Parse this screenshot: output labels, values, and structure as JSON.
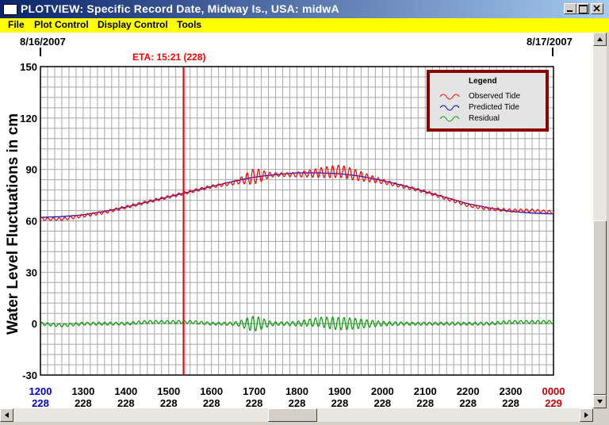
{
  "window": {
    "title": "PLOTVIEW: Specific Record Date, Midway Is., USA: midwA"
  },
  "menu": [
    {
      "label": "File"
    },
    {
      "label": "Plot Control"
    },
    {
      "label": "Display Control"
    },
    {
      "label": "Tools"
    }
  ],
  "header": {
    "left_date": "8/16/2007",
    "right_date": "8/17/2007",
    "eta_label": "ETA: 15:21 (228)"
  },
  "colors": {
    "observed": "#ff0000",
    "predicted": "#0000cc",
    "residual": "#00a000",
    "eta_line": "#ff0000",
    "menu_bg": "#ffff00",
    "title_bg": "#0a246a"
  },
  "chart_data": {
    "type": "line",
    "ylabel": "Water Level Fluctuations in cm",
    "ylim": [
      -30,
      150
    ],
    "yticks": [
      -30,
      0,
      30,
      60,
      90,
      120,
      150
    ],
    "xlim": [
      12.0,
      24.0
    ],
    "xticks": [
      {
        "time": "1200",
        "day": "228",
        "highlight": "blue"
      },
      {
        "time": "1300",
        "day": "228"
      },
      {
        "time": "1400",
        "day": "228"
      },
      {
        "time": "1500",
        "day": "228"
      },
      {
        "time": "1600",
        "day": "228"
      },
      {
        "time": "1700",
        "day": "228"
      },
      {
        "time": "1800",
        "day": "228"
      },
      {
        "time": "1900",
        "day": "228"
      },
      {
        "time": "2000",
        "day": "228"
      },
      {
        "time": "2100",
        "day": "228"
      },
      {
        "time": "2200",
        "day": "228"
      },
      {
        "time": "2300",
        "day": "228"
      },
      {
        "time": "0000",
        "day": "229",
        "highlight": "red"
      }
    ],
    "eta_x": 15.35,
    "grid": true,
    "legend": {
      "title": "Legend",
      "placement": "top-right"
    },
    "series": [
      {
        "name": "Observed Tide",
        "color": "#ff0000",
        "x": [
          12.0,
          12.5,
          13.0,
          13.5,
          14.0,
          14.5,
          15.0,
          15.5,
          16.0,
          16.5,
          17.0,
          17.5,
          18.0,
          18.5,
          19.0,
          19.5,
          20.0,
          20.5,
          21.0,
          21.5,
          22.0,
          22.5,
          23.0,
          23.5,
          24.0
        ],
        "y": [
          61,
          61,
          63,
          65,
          68,
          71,
          74,
          77,
          80,
          82,
          86,
          87,
          87,
          88,
          89,
          86,
          83,
          80,
          77,
          73,
          69,
          67,
          66,
          66,
          65
        ]
      },
      {
        "name": "Predicted Tide",
        "color": "#0000cc",
        "x": [
          12.0,
          12.5,
          13.0,
          13.5,
          14.0,
          14.5,
          15.0,
          15.5,
          16.0,
          16.5,
          17.0,
          17.5,
          18.0,
          18.5,
          19.0,
          19.5,
          20.0,
          20.5,
          21.0,
          21.5,
          22.0,
          22.5,
          23.0,
          23.5,
          24.0
        ],
        "y": [
          62,
          62.5,
          63.5,
          65.5,
          68,
          71,
          74,
          77,
          80,
          83,
          85.5,
          87,
          88,
          88,
          87.5,
          86,
          83.5,
          80.5,
          77,
          73.5,
          70,
          67.5,
          65.5,
          64.5,
          64
        ]
      },
      {
        "name": "Residual",
        "color": "#00a000",
        "x": [
          12.0,
          12.5,
          13.0,
          13.5,
          14.0,
          14.5,
          15.0,
          15.5,
          16.0,
          16.5,
          17.0,
          17.5,
          18.0,
          18.5,
          19.0,
          19.5,
          20.0,
          20.5,
          21.0,
          21.5,
          22.0,
          22.5,
          23.0,
          23.5,
          24.0
        ],
        "y": [
          0,
          -1,
          0,
          0,
          0,
          1,
          1,
          1,
          0,
          0,
          0,
          0,
          0,
          1,
          0,
          0,
          0,
          0,
          0,
          0,
          0,
          0,
          1,
          1,
          1
        ]
      }
    ]
  }
}
